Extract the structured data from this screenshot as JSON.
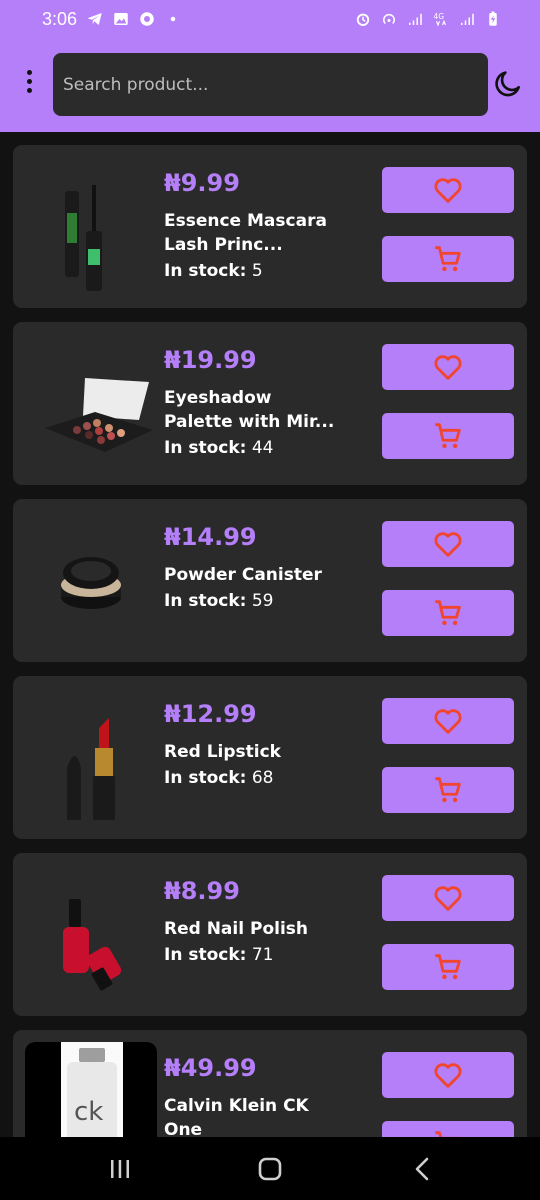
{
  "status_bar": {
    "time": "3:06",
    "left_icons": [
      "telegram-icon",
      "gallery-icon",
      "viber-icon",
      "dot-icon"
    ],
    "right_icons": [
      "alarm-icon",
      "hotspot-icon",
      "signal-icon",
      "4g-icon",
      "signal-icon",
      "battery-charging-icon"
    ]
  },
  "header": {
    "menu_icon": "more-vertical-icon",
    "search_placeholder": "Search product...",
    "theme_icon": "moon-icon"
  },
  "colors": {
    "accent": "#b47ff9",
    "background": "#121212",
    "card": "#2a2a2a",
    "icon_red": "#f2452e"
  },
  "products": [
    {
      "price": "₦9.99",
      "name_line1": "Essence Mascara",
      "name_line2": "Lash Princ...",
      "stock_label": "In stock:",
      "stock_value": "5"
    },
    {
      "price": "₦19.99",
      "name_line1": "Eyeshadow",
      "name_line2": "Palette with Mir...",
      "stock_label": "In stock:",
      "stock_value": "44"
    },
    {
      "price": "₦14.99",
      "name_line1": "Powder Canister",
      "name_line2": "",
      "stock_label": "In stock:",
      "stock_value": "59"
    },
    {
      "price": "₦12.99",
      "name_line1": "Red Lipstick",
      "name_line2": "",
      "stock_label": "In stock:",
      "stock_value": "68"
    },
    {
      "price": "₦8.99",
      "name_line1": "Red Nail Polish",
      "name_line2": "",
      "stock_label": "In stock:",
      "stock_value": "71"
    },
    {
      "price": "₦49.99",
      "name_line1": "Calvin Klein CK",
      "name_line2": "One",
      "stock_label": "",
      "stock_value": ""
    }
  ],
  "nav": {
    "recent": "recent-apps-icon",
    "home": "home-icon",
    "back": "back-icon"
  }
}
